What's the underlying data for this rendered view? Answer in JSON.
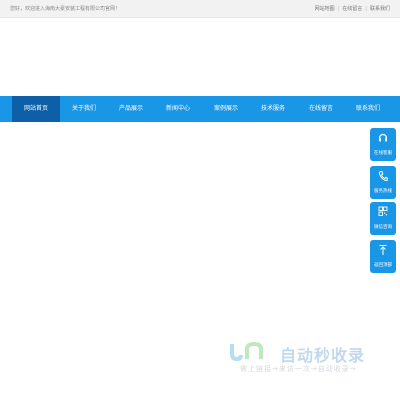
{
  "topbar": {
    "welcome": "您好，欢迎进入海南大豪安装工程有限公司官网！",
    "links": [
      "网站地图",
      "在线留言",
      "联系我们"
    ]
  },
  "nav": {
    "items": [
      "网站首页",
      "关于我们",
      "产品展示",
      "新闻中心",
      "案例展示",
      "技术服务",
      "在线留言",
      "联系我们"
    ],
    "active_index": 0
  },
  "sidebar": {
    "items": [
      {
        "label": "在线客服",
        "icon": "headset-icon"
      },
      {
        "label": "服务热线",
        "icon": "phone-icon"
      },
      {
        "label": "微信咨询",
        "icon": "qrcode-icon"
      },
      {
        "label": "返回顶部",
        "icon": "arrow-up-icon"
      }
    ]
  },
  "watermark": {
    "logo_text": "JN",
    "title": "自动秒收录",
    "subtitle": "做上链接→来访一次→自动收录→"
  },
  "colors": {
    "primary": "#1a96e6",
    "active": "#0d5fa8",
    "topbar_bg": "#f2f2f2"
  }
}
